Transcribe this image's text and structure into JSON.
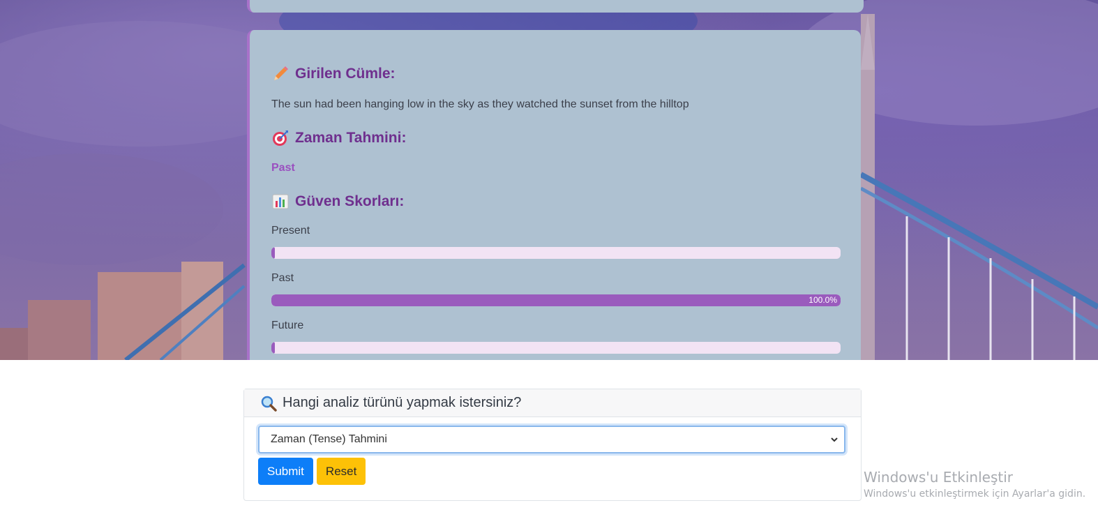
{
  "result": {
    "sentence_title": "Girilen Cümle:",
    "sentence": "The sun had been hanging low in the sky as they watched the sunset from the hilltop",
    "prediction_title": "Zaman Tahmini:",
    "prediction": "Past",
    "scores_title": "Güven Skorları:",
    "scores": [
      {
        "label": "Present",
        "value": 0.0,
        "value_text": ""
      },
      {
        "label": "Past",
        "value": 100.0,
        "value_text": "100.0%"
      },
      {
        "label": "Future",
        "value": 0.0,
        "value_text": ""
      }
    ]
  },
  "form": {
    "header": "Hangi analiz türünü yapmak istersiniz?",
    "selected_option": "Zaman (Tense) Tahmini",
    "submit_label": "Submit",
    "reset_label": "Reset"
  },
  "watermark": {
    "title": "Windows'u Etkinleştir",
    "subtitle": "Windows'u etkinleştirmek için Ayarlar'a gidin."
  },
  "colors": {
    "accent": "#9a5bbd",
    "title": "#6f2f8e",
    "submit": "#0d7ef8",
    "reset": "#fdc107"
  },
  "icons": {
    "sentence": "pencil-icon",
    "prediction": "target-icon",
    "scores": "bar-chart-icon",
    "form": "magnifier-icon",
    "select": "chevron-down-icon"
  }
}
